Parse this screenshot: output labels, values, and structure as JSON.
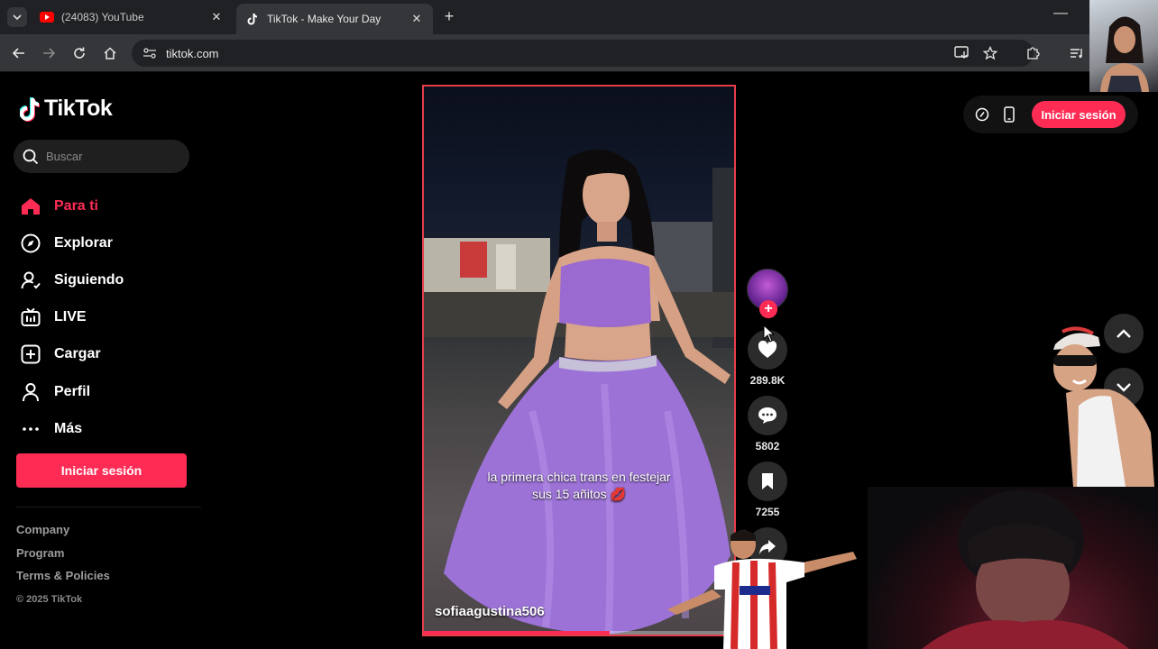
{
  "browser": {
    "tabs": [
      {
        "title": "(24083) YouTube",
        "icon": "youtube-icon",
        "active": false
      },
      {
        "title": "TikTok - Make Your Day",
        "icon": "tiktok-icon",
        "active": true
      }
    ],
    "url": "tiktok.com"
  },
  "brand": {
    "name": "TikTok",
    "accent": "#fe2c55"
  },
  "search": {
    "placeholder": "Buscar"
  },
  "nav": [
    {
      "label": "Para ti",
      "icon": "home-icon",
      "active": true
    },
    {
      "label": "Explorar",
      "icon": "compass-icon",
      "active": false
    },
    {
      "label": "Siguiendo",
      "icon": "following-icon",
      "active": false
    },
    {
      "label": "LIVE",
      "icon": "live-tv-icon",
      "active": false
    },
    {
      "label": "Cargar",
      "icon": "upload-icon",
      "active": false
    },
    {
      "label": "Perfil",
      "icon": "profile-icon",
      "active": false
    },
    {
      "label": "Más",
      "icon": "more-icon",
      "active": false
    }
  ],
  "sidebar_login": "Iniciar sesión",
  "footer": {
    "links": [
      "Company",
      "Program",
      "Terms & Policies"
    ],
    "copyright": "© 2025 TikTok"
  },
  "video": {
    "caption_line1": "la primera chica trans en festejar",
    "caption_line2": "sus 15 añitos 💋",
    "author": "sofiaagustina506",
    "progress": 0.6
  },
  "actions": {
    "likes": "289.8K",
    "comments": "5802",
    "saves": "7255"
  },
  "top_right": {
    "login": "Iniciar sesión"
  }
}
